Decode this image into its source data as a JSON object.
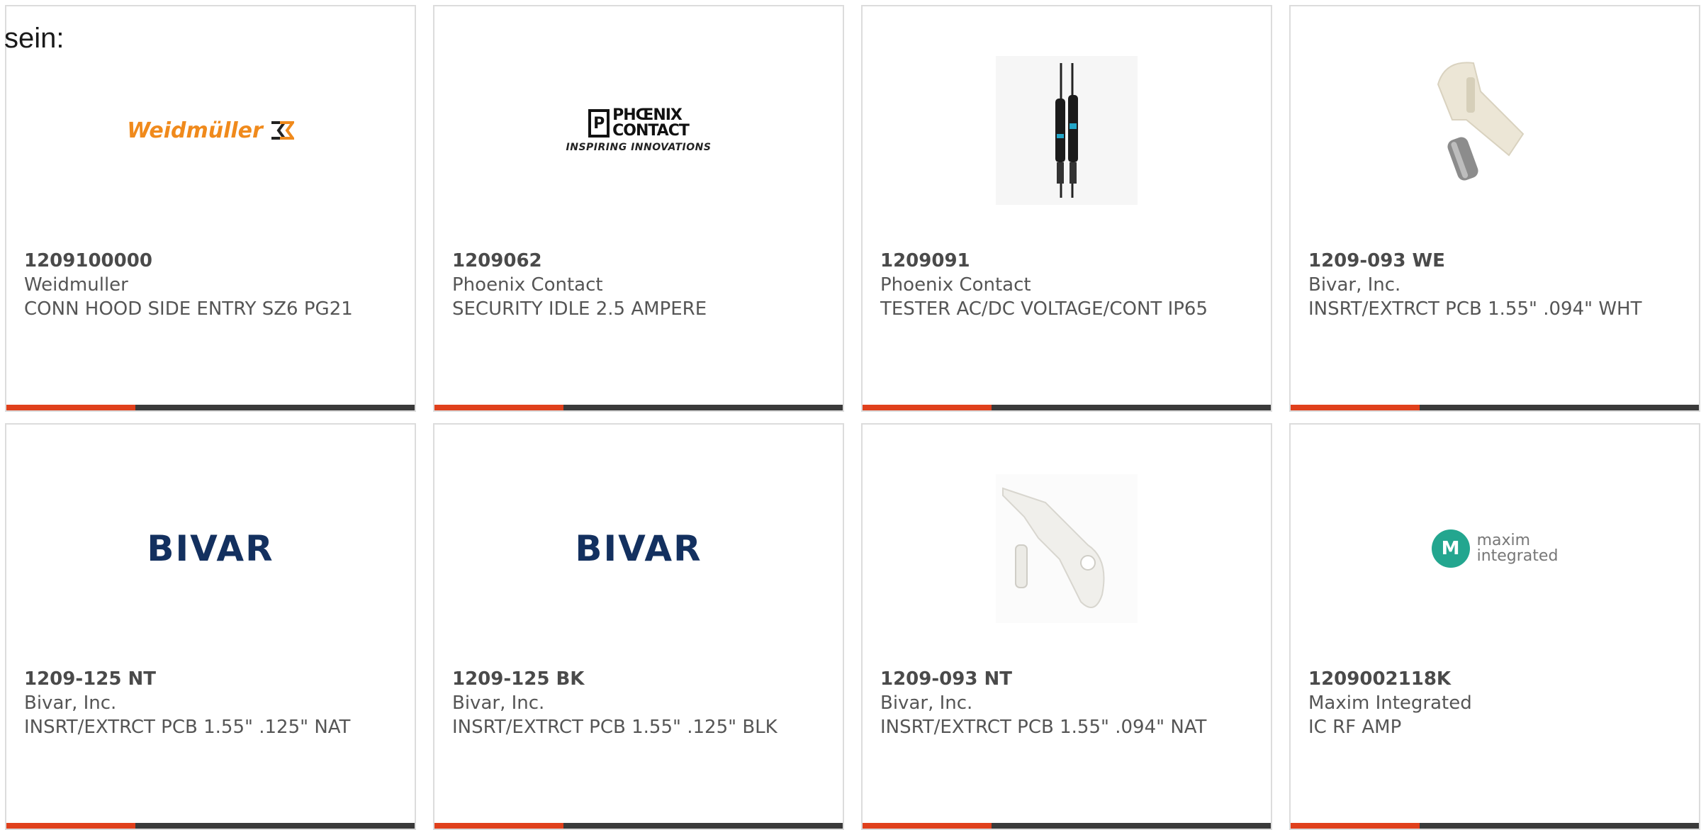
{
  "lead_text": "sein:",
  "colors": {
    "accent_bar": "#e0401c",
    "dark_bar": "#3a3a3a",
    "bivar_blue": "#13305f",
    "weidmuller_orange": "#f08a1c",
    "maxim_teal": "#23a68f"
  },
  "products": [
    {
      "part_number": "1209100000",
      "manufacturer": "Weidmuller",
      "description": "CONN HOOD SIDE ENTRY SZ6 PG21",
      "image": {
        "type": "logo-weidmuller",
        "text": "Weidmüller",
        "icon": "weidmuller-mark-icon"
      }
    },
    {
      "part_number": "1209062",
      "manufacturer": "Phoenix Contact",
      "description": "SECURITY IDLE 2.5 AMPERE",
      "image": {
        "type": "logo-phoenix",
        "line1": "PHŒNIX",
        "line2": "CONTACT",
        "tagline": "INSPIRING INNOVATIONS"
      }
    },
    {
      "part_number": "1209091",
      "manufacturer": "Phoenix Contact",
      "description": "TESTER AC/DC VOLTAGE/CONT IP65",
      "image": {
        "type": "photo-tester",
        "icon": "voltage-tester-photo"
      }
    },
    {
      "part_number": "1209-093 WE",
      "manufacturer": "Bivar, Inc.",
      "description": "INSRT/EXTRCT PCB 1.55\" .094\" WHT",
      "image": {
        "type": "photo-extractor-cream",
        "icon": "pcb-extractor-photo"
      }
    },
    {
      "part_number": "1209-125 NT",
      "manufacturer": "Bivar, Inc.",
      "description": "INSRT/EXTRCT PCB 1.55\" .125\" NAT",
      "image": {
        "type": "logo-bivar",
        "text": "BIVAR"
      }
    },
    {
      "part_number": "1209-125 BK",
      "manufacturer": "Bivar, Inc.",
      "description": "INSRT/EXTRCT PCB 1.55\" .125\" BLK",
      "image": {
        "type": "logo-bivar",
        "text": "BIVAR"
      }
    },
    {
      "part_number": "1209-093 NT",
      "manufacturer": "Bivar, Inc.",
      "description": "INSRT/EXTRCT PCB 1.55\" .094\" NAT",
      "image": {
        "type": "photo-extractor-white",
        "icon": "pcb-extractor-photo"
      }
    },
    {
      "part_number": "1209002118K",
      "manufacturer": "Maxim Integrated",
      "description": "IC RF AMP",
      "image": {
        "type": "logo-maxim",
        "mark": "M",
        "line1": "maxim",
        "line2": "integrated"
      }
    }
  ]
}
